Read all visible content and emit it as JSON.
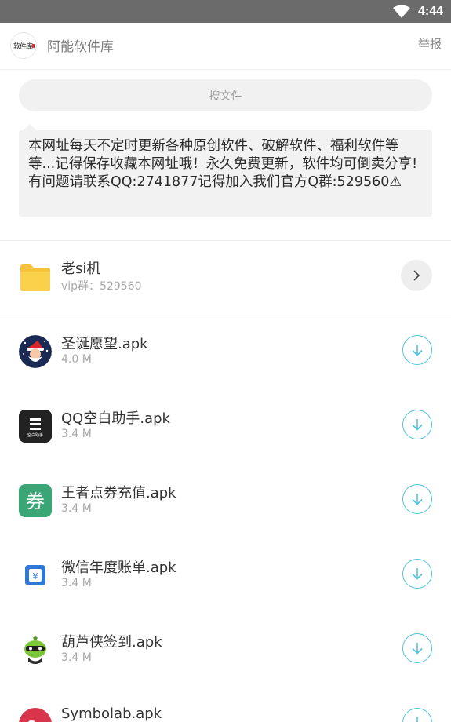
{
  "status_bar": {
    "time": "4:44",
    "icons": [
      "wifi-icon"
    ]
  },
  "header": {
    "site_name": "阿能软件库",
    "report_label": "举报",
    "logo_text": "软件库"
  },
  "search": {
    "placeholder": "搜文件"
  },
  "notice": {
    "text": "本网址每天不定时更新各种原创软件、破解软件、福利软件等等...记得保存收藏本网址哦！永久免费更新，软件均可倒卖分享!有问题请联系QQ:2741877记得加入我们官方Q群:529560⚠"
  },
  "folder": {
    "title": "老si机",
    "subtitle": "vip群：529560",
    "icon": "folder-icon",
    "action_icon": "chevron-right-icon"
  },
  "files": [
    {
      "name": "圣诞愿望.apk",
      "size": "4.0 M",
      "icon": "santa-app-icon"
    },
    {
      "name": "QQ空白助手.apk",
      "size": "3.4 M",
      "icon": "qq-blank-app-icon",
      "icon_text": "空白助手"
    },
    {
      "name": "王者点券充值.apk",
      "size": "3.4 M",
      "icon": "coupon-app-icon",
      "icon_text": "券"
    },
    {
      "name": "微信年度账单.apk",
      "size": "3.4 M",
      "icon": "wechat-bill-app-icon",
      "icon_text": "¥"
    },
    {
      "name": "葫芦侠签到.apk",
      "size": "3.4 M",
      "icon": "huluxia-app-icon"
    },
    {
      "name": "Symbolab.apk",
      "size": "",
      "icon": "symbolab-app-icon",
      "icon_text": "Sy"
    }
  ],
  "colors": {
    "accent": "#4fc3e0",
    "status_bar": "#6b6b6b",
    "folder": "#fbd14b"
  }
}
